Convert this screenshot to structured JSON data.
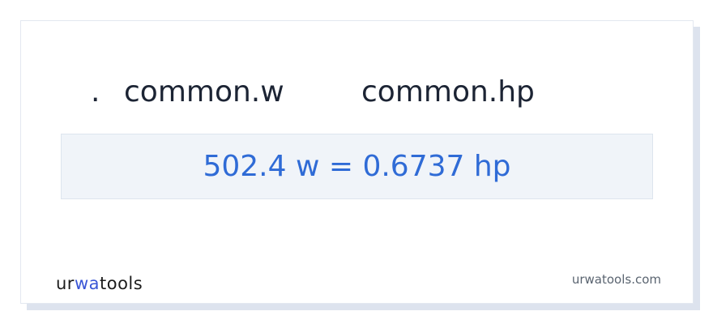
{
  "heading": {
    "dot": ".",
    "from_unit": "common.w",
    "to_unit": "common.hp"
  },
  "result": {
    "text": "502.4 w = 0.6737 hp"
  },
  "footer": {
    "logo": {
      "part1": "ur",
      "part2": "wa",
      "part3": "tools"
    },
    "site": "urwatools.com"
  },
  "colors": {
    "result_text": "#2f6bd6",
    "result_bg": "#f0f4f9",
    "logo_accent": "#3a56d6"
  }
}
